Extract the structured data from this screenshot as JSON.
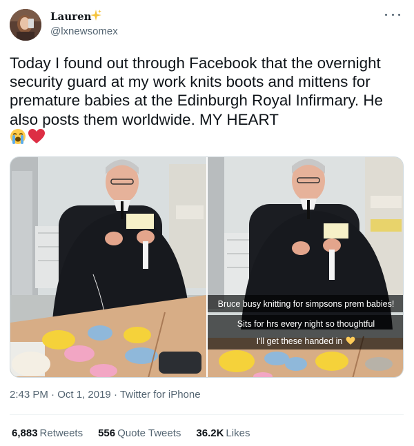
{
  "author": {
    "display_name": "Lauren",
    "badge_icon": "sparkles-icon",
    "handle": "@lxnewsomex"
  },
  "tweet": {
    "text": "Today I found out through Facebook that the overnight security guard at my work knits boots and mittens for premature babies at the Edinburgh Royal Infirmary. He also posts them worldwide. MY HEART",
    "emojis": [
      "loudly-crying-face-icon",
      "red-heart-icon"
    ]
  },
  "media": {
    "photos": [
      {
        "description_icon": "photo-knitting-left"
      },
      {
        "description_icon": "photo-knitting-right"
      }
    ],
    "captions": [
      "Bruce busy knitting for simpsons prem babies!",
      "Sits for hrs every night so thoughtful",
      "I'll get these handed in"
    ],
    "caption_emoji": "yellow-heart-icon"
  },
  "meta": {
    "time": "2:43 PM",
    "separator": "·",
    "date": "Oct 1, 2019",
    "source": "Twitter for iPhone"
  },
  "stats": {
    "retweets_count": "6,883",
    "retweets_label": "Retweets",
    "quotes_count": "556",
    "quotes_label": "Quote Tweets",
    "likes_count": "36.2K",
    "likes_label": "Likes"
  },
  "colors": {
    "text": "#0f1419",
    "secondary": "#536471",
    "border": "#cfd9de",
    "sparkle": "#f5c33b",
    "heart": "#dd2e44"
  }
}
